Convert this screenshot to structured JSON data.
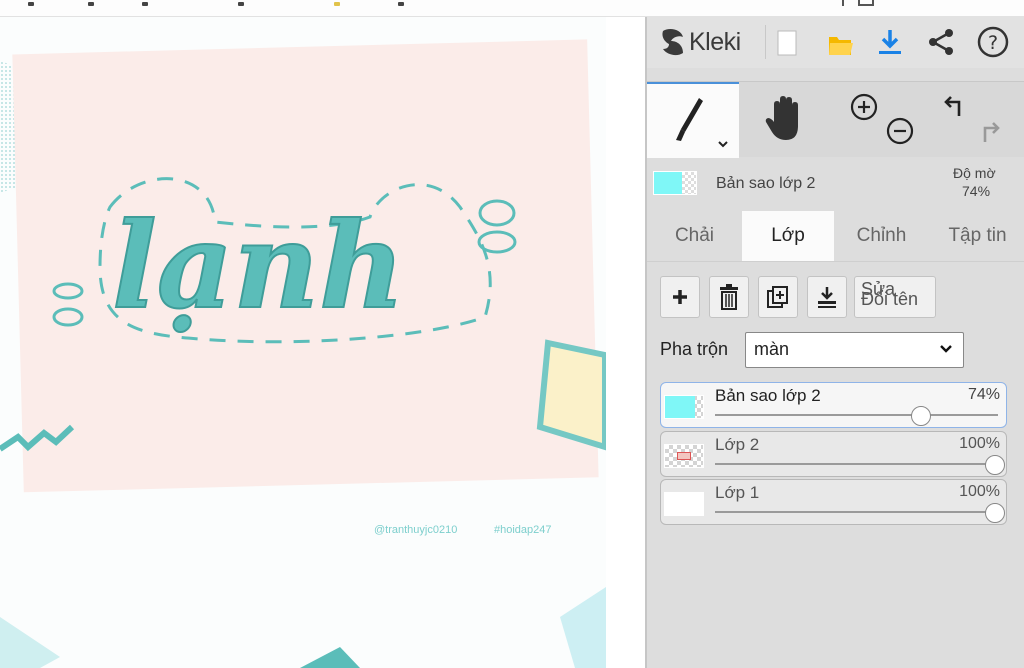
{
  "app": {
    "name": "Kleki"
  },
  "artwork": {
    "lettering": "lạnh",
    "credit_user": "@tranthuyjc0210",
    "credit_tag": "#hoidap247"
  },
  "toolbar": {
    "icons": [
      "new-file-icon",
      "open-folder-icon",
      "download-icon",
      "share-icon",
      "help-icon"
    ]
  },
  "tools": {
    "brush": "brush-icon",
    "hand": "hand-icon",
    "zoom_in": "zoom-in-icon",
    "zoom_out": "zoom-out-icon",
    "undo": "undo-icon",
    "redo": "redo-icon"
  },
  "current_layer": {
    "name": "Bản sao lớp 2",
    "opacity_label": "Độ mờ",
    "opacity_value": "74%"
  },
  "tabs": [
    {
      "label": "Chải",
      "active": false
    },
    {
      "label": "Lớp",
      "active": true
    },
    {
      "label": "Chỉnh",
      "active": false
    },
    {
      "label": "Tập tin",
      "active": false
    }
  ],
  "layer_actions": {
    "rename_line1": "Sửa",
    "rename_line2": "Đổi tên"
  },
  "blend": {
    "label": "Pha trộn",
    "value": "màn"
  },
  "layers": [
    {
      "name": "Bản sao lớp 2",
      "opacity": "74%",
      "opacity_value": 0.74,
      "selected": true
    },
    {
      "name": "Lớp 2",
      "opacity": "100%",
      "opacity_value": 1.0,
      "selected": false
    },
    {
      "name": "Lớp 1",
      "opacity": "100%",
      "opacity_value": 1.0,
      "selected": false
    }
  ],
  "colors": {
    "accent": "#4a90d9",
    "lettering": "#5bbdb9",
    "thumb_cyan": "#7ff7f7",
    "panel_bg": "#dddddd"
  }
}
